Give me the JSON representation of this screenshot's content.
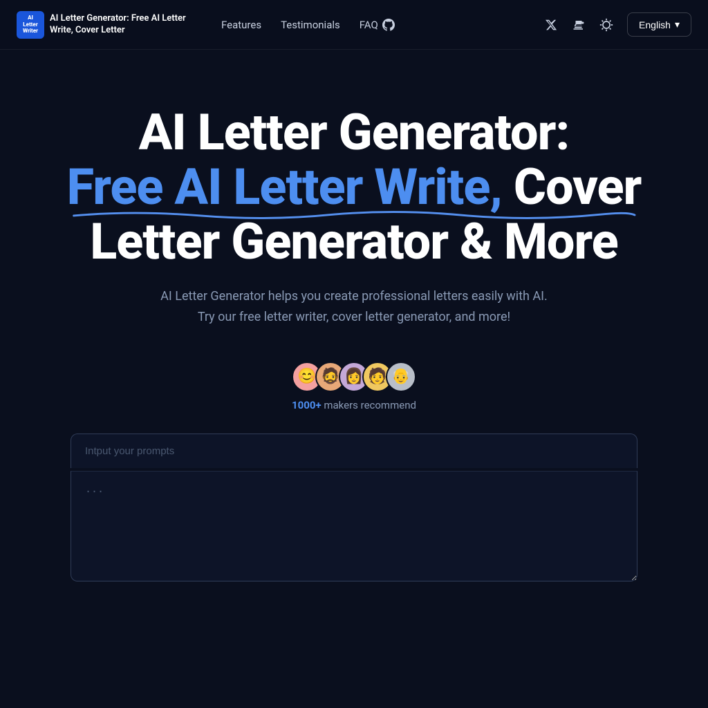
{
  "nav": {
    "logo_text": "AI Letter\nWriter",
    "site_title": "AI Letter Generator: Free AI Letter Write, Cover Letter",
    "links": [
      {
        "label": "Features",
        "id": "features"
      },
      {
        "label": "Testimonials",
        "id": "testimonials"
      },
      {
        "label": "FAQ",
        "id": "faq"
      }
    ],
    "language": "English",
    "language_chevron": "▾"
  },
  "hero": {
    "title_line1": "AI Letter Generator:",
    "title_line2_blue": "Free AI Letter Write,",
    "title_line2_white": " Cover",
    "title_line3": "Letter Generator & More",
    "subtitle": "AI Letter Generator helps you create professional letters easily with AI. Try our free letter writer, cover letter generator, and more!",
    "recommend_count": "1000+",
    "recommend_text": " makers recommend"
  },
  "input": {
    "placeholder": "Intput your prompts",
    "output_placeholder": "..."
  },
  "avatars": [
    {
      "emoji": "😊",
      "color": "#f4a0a0"
    },
    {
      "emoji": "🧔",
      "color": "#f4b87a"
    },
    {
      "emoji": "👩",
      "color": "#c4a0d4"
    },
    {
      "emoji": "🧑",
      "color": "#f4c870"
    },
    {
      "emoji": "👴",
      "color": "#b0b8c4"
    }
  ]
}
